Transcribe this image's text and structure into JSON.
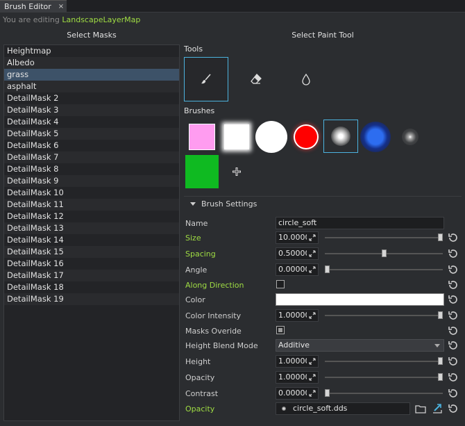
{
  "tab": {
    "title": "Brush Editor",
    "close": "×"
  },
  "editing": {
    "prefix": "You are editing",
    "asset": "LandscapeLayerMap"
  },
  "headers": {
    "masks": "Select Masks",
    "paint_tool": "Select Paint Tool"
  },
  "masks": [
    "Heightmap",
    "Albedo",
    "grass",
    "asphalt",
    "DetailMask 2",
    "DetailMask 3",
    "DetailMask 4",
    "DetailMask 5",
    "DetailMask 6",
    "DetailMask 7",
    "DetailMask 8",
    "DetailMask 9",
    "DetailMask 10",
    "DetailMask 11",
    "DetailMask 12",
    "DetailMask 13",
    "DetailMask 14",
    "DetailMask 15",
    "DetailMask 16",
    "DetailMask 17",
    "DetailMask 18",
    "DetailMask 19"
  ],
  "selected_mask": "grass",
  "tools": {
    "label": "Tools",
    "items": [
      "brush-icon",
      "eraser-icon",
      "drop-icon"
    ],
    "active": "brush-icon"
  },
  "brushes": {
    "label": "Brushes",
    "selected": "circle-soft-white"
  },
  "colors": {
    "accent": "#4cb3df",
    "green_label": "#9fdc43",
    "selection": "#3d5268",
    "brush_pink": "#ff9cf0",
    "brush_green": "#0fba21",
    "brush_red": "#ff0000"
  },
  "settings": {
    "header": "Brush Settings",
    "name": {
      "label": "Name",
      "value": "circle_soft"
    },
    "size": {
      "label": "Size",
      "value": "10.00000",
      "slider": 1.0
    },
    "spacing": {
      "label": "Spacing",
      "value": "0.50000",
      "slider": 0.5
    },
    "angle": {
      "label": "Angle",
      "value": "0.00000",
      "slider": 0.0
    },
    "along_direction": {
      "label": "Along Direction",
      "checked": false
    },
    "color": {
      "label": "Color",
      "value": "#ffffff"
    },
    "color_intensity": {
      "label": "Color Intensity",
      "value": "1.00000",
      "slider": 1.0
    },
    "masks_override": {
      "label": "Masks Overide",
      "checked": true
    },
    "height_blend": {
      "label": "Height Blend Mode",
      "value": "Additive"
    },
    "height": {
      "label": "Height",
      "value": "1.00000",
      "slider": 1.0
    },
    "opacity": {
      "label": "Opacity",
      "value": "1.00000",
      "slider": 1.0
    },
    "contrast": {
      "label": "Contrast",
      "value": "0.00000",
      "slider": 0.0
    },
    "opacity_tex": {
      "label": "Opacity",
      "value": "circle_soft.dds"
    }
  }
}
